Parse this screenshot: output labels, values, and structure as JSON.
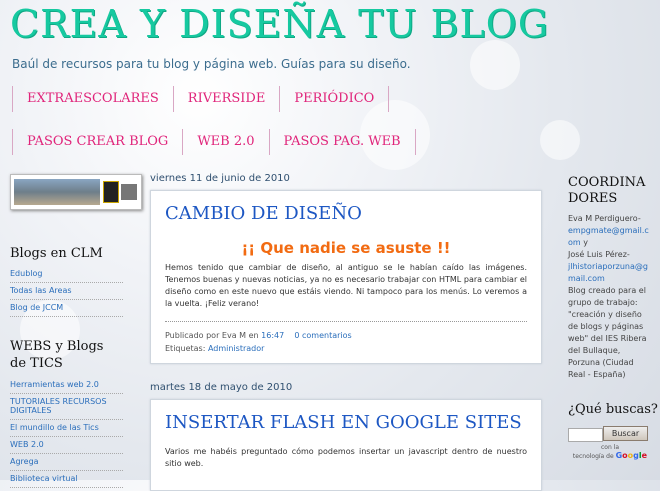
{
  "blog_title": "CREA Y DISEÑA TU BLOG",
  "description": "Baúl de recursos para tu blog y página web. Guías para su diseño.",
  "nav_row1": [
    "EXTRAESCOLARES",
    "RIVERSIDE",
    "PERIÓDICO"
  ],
  "nav_row2": [
    "PASOS CREAR BLOG",
    "WEB 2.0",
    "PASOS PAG. WEB"
  ],
  "left_sidebar": {
    "clm_heading": "Blogs en CLM",
    "clm_links": [
      "Edublog",
      "Todas las Areas",
      "Blog de JCCM"
    ],
    "webs_heading": "WEBS y Blogs de TICS",
    "webs_links": [
      "Herramientas web 2.0",
      "TUTORIALES RECURSOS DIGITALES",
      "El mundillo de las Tics",
      "WEB 2.0",
      "Agrega",
      "Biblioteca virtual"
    ]
  },
  "posts": [
    {
      "date": "viernes 11 de junio de 2010",
      "title": "CAMBIO DE DISEÑO",
      "highlight": "¡¡ Que nadie se asuste !!",
      "body": "Hemos tenido que cambiar de diseño, al antiguo se le habían caído las imágenes. Tenemos buenas y nuevas noticias, ya no es necesario trabajar con HTML para cambiar el diseño como en este nuevo que estáis viendo. Ni tampoco para los menús. Lo veremos a la vuelta. ¡Feliz verano!",
      "published_prefix": "Publicado por",
      "author": "Eva M",
      "time_prefix": "en",
      "time": "16:47",
      "comments": "0 comentarios",
      "labels_prefix": "Etiquetas:",
      "label": "Administrador"
    },
    {
      "date": "martes 18 de mayo de 2010",
      "title": "INSERTAR FLASH EN GOOGLE SITES",
      "body": "Varios me habéis preguntado cómo podemos insertar un javascript dentro de nuestro sitio web."
    }
  ],
  "right_sidebar": {
    "coord_heading_1": "COORDINA",
    "coord_heading_2": "DORES",
    "person1": "Eva M Perdiguero-",
    "email1": "empgmate@gmail.com",
    "and": "y",
    "person2": "José Luis Pérez-",
    "email2": "jlhistoriaporzuna@gmail.com",
    "about": "Blog creado para el grupo de trabajo: \"creación y diseño de blogs y páginas web\" del IES Ribera del Bullaque, Porzuna (Ciudad Real - España)",
    "search_heading": "¿Qué buscas?",
    "search_button": "Buscar",
    "search_value": "",
    "powered_1": "con la",
    "powered_2": "tecnología de"
  },
  "colors": {
    "title": "#16c9a0",
    "nav": "#e0247a",
    "post_title": "#1d57c3",
    "highlight": "#f26b12",
    "link": "#2a6ebb"
  }
}
